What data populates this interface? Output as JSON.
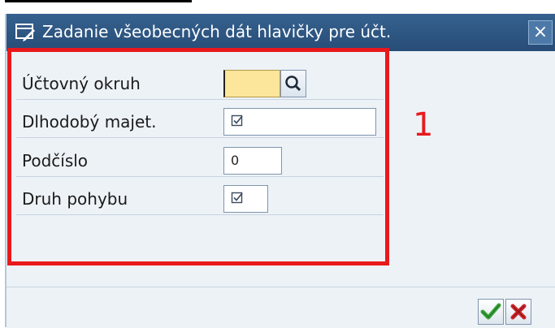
{
  "dialog": {
    "title": "Zadanie všeobecných dát hlavičky pre účt.",
    "close_glyph": "×"
  },
  "form": {
    "rows": [
      {
        "label": "Účtovný okruh",
        "value": "",
        "required": true
      },
      {
        "label": "Dlhodobý majet.",
        "value": "",
        "checkbox": true
      },
      {
        "label": "Podčíslo",
        "value": "0"
      },
      {
        "label": "Druh pohybu",
        "value": "",
        "checkbox": true
      }
    ]
  },
  "annotation": {
    "number": "1",
    "color": "#e8191c"
  },
  "footer": {
    "buttons": [
      {
        "icon": "checkmark-icon",
        "color": "#3aa53a"
      },
      {
        "icon": "cancel-icon",
        "color": "#d0262a"
      }
    ]
  },
  "colors": {
    "titlebar": "#2f5a88",
    "body": "#edf2f7",
    "required_field": "#fbe69b"
  }
}
